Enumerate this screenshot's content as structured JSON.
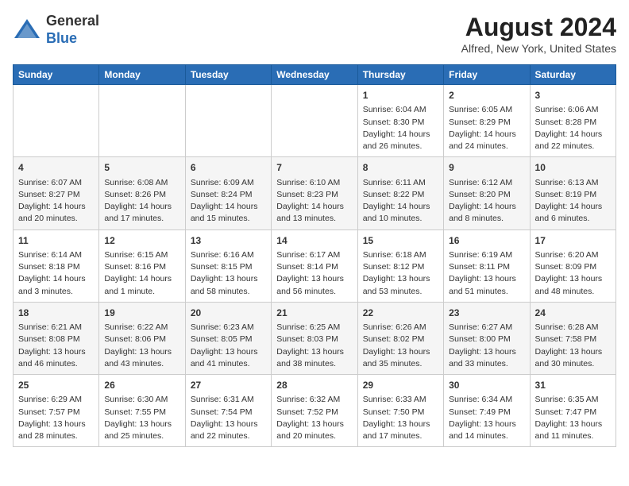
{
  "header": {
    "logo_line1": "General",
    "logo_line2": "Blue",
    "title": "August 2024",
    "subtitle": "Alfred, New York, United States"
  },
  "days_of_week": [
    "Sunday",
    "Monday",
    "Tuesday",
    "Wednesday",
    "Thursday",
    "Friday",
    "Saturday"
  ],
  "weeks": [
    [
      {
        "day": "",
        "lines": []
      },
      {
        "day": "",
        "lines": []
      },
      {
        "day": "",
        "lines": []
      },
      {
        "day": "",
        "lines": []
      },
      {
        "day": "1",
        "lines": [
          "Sunrise: 6:04 AM",
          "Sunset: 8:30 PM",
          "Daylight: 14 hours",
          "and 26 minutes."
        ]
      },
      {
        "day": "2",
        "lines": [
          "Sunrise: 6:05 AM",
          "Sunset: 8:29 PM",
          "Daylight: 14 hours",
          "and 24 minutes."
        ]
      },
      {
        "day": "3",
        "lines": [
          "Sunrise: 6:06 AM",
          "Sunset: 8:28 PM",
          "Daylight: 14 hours",
          "and 22 minutes."
        ]
      }
    ],
    [
      {
        "day": "4",
        "lines": [
          "Sunrise: 6:07 AM",
          "Sunset: 8:27 PM",
          "Daylight: 14 hours",
          "and 20 minutes."
        ]
      },
      {
        "day": "5",
        "lines": [
          "Sunrise: 6:08 AM",
          "Sunset: 8:26 PM",
          "Daylight: 14 hours",
          "and 17 minutes."
        ]
      },
      {
        "day": "6",
        "lines": [
          "Sunrise: 6:09 AM",
          "Sunset: 8:24 PM",
          "Daylight: 14 hours",
          "and 15 minutes."
        ]
      },
      {
        "day": "7",
        "lines": [
          "Sunrise: 6:10 AM",
          "Sunset: 8:23 PM",
          "Daylight: 14 hours",
          "and 13 minutes."
        ]
      },
      {
        "day": "8",
        "lines": [
          "Sunrise: 6:11 AM",
          "Sunset: 8:22 PM",
          "Daylight: 14 hours",
          "and 10 minutes."
        ]
      },
      {
        "day": "9",
        "lines": [
          "Sunrise: 6:12 AM",
          "Sunset: 8:20 PM",
          "Daylight: 14 hours",
          "and 8 minutes."
        ]
      },
      {
        "day": "10",
        "lines": [
          "Sunrise: 6:13 AM",
          "Sunset: 8:19 PM",
          "Daylight: 14 hours",
          "and 6 minutes."
        ]
      }
    ],
    [
      {
        "day": "11",
        "lines": [
          "Sunrise: 6:14 AM",
          "Sunset: 8:18 PM",
          "Daylight: 14 hours",
          "and 3 minutes."
        ]
      },
      {
        "day": "12",
        "lines": [
          "Sunrise: 6:15 AM",
          "Sunset: 8:16 PM",
          "Daylight: 14 hours",
          "and 1 minute."
        ]
      },
      {
        "day": "13",
        "lines": [
          "Sunrise: 6:16 AM",
          "Sunset: 8:15 PM",
          "Daylight: 13 hours",
          "and 58 minutes."
        ]
      },
      {
        "day": "14",
        "lines": [
          "Sunrise: 6:17 AM",
          "Sunset: 8:14 PM",
          "Daylight: 13 hours",
          "and 56 minutes."
        ]
      },
      {
        "day": "15",
        "lines": [
          "Sunrise: 6:18 AM",
          "Sunset: 8:12 PM",
          "Daylight: 13 hours",
          "and 53 minutes."
        ]
      },
      {
        "day": "16",
        "lines": [
          "Sunrise: 6:19 AM",
          "Sunset: 8:11 PM",
          "Daylight: 13 hours",
          "and 51 minutes."
        ]
      },
      {
        "day": "17",
        "lines": [
          "Sunrise: 6:20 AM",
          "Sunset: 8:09 PM",
          "Daylight: 13 hours",
          "and 48 minutes."
        ]
      }
    ],
    [
      {
        "day": "18",
        "lines": [
          "Sunrise: 6:21 AM",
          "Sunset: 8:08 PM",
          "Daylight: 13 hours",
          "and 46 minutes."
        ]
      },
      {
        "day": "19",
        "lines": [
          "Sunrise: 6:22 AM",
          "Sunset: 8:06 PM",
          "Daylight: 13 hours",
          "and 43 minutes."
        ]
      },
      {
        "day": "20",
        "lines": [
          "Sunrise: 6:23 AM",
          "Sunset: 8:05 PM",
          "Daylight: 13 hours",
          "and 41 minutes."
        ]
      },
      {
        "day": "21",
        "lines": [
          "Sunrise: 6:25 AM",
          "Sunset: 8:03 PM",
          "Daylight: 13 hours",
          "and 38 minutes."
        ]
      },
      {
        "day": "22",
        "lines": [
          "Sunrise: 6:26 AM",
          "Sunset: 8:02 PM",
          "Daylight: 13 hours",
          "and 35 minutes."
        ]
      },
      {
        "day": "23",
        "lines": [
          "Sunrise: 6:27 AM",
          "Sunset: 8:00 PM",
          "Daylight: 13 hours",
          "and 33 minutes."
        ]
      },
      {
        "day": "24",
        "lines": [
          "Sunrise: 6:28 AM",
          "Sunset: 7:58 PM",
          "Daylight: 13 hours",
          "and 30 minutes."
        ]
      }
    ],
    [
      {
        "day": "25",
        "lines": [
          "Sunrise: 6:29 AM",
          "Sunset: 7:57 PM",
          "Daylight: 13 hours",
          "and 28 minutes."
        ]
      },
      {
        "day": "26",
        "lines": [
          "Sunrise: 6:30 AM",
          "Sunset: 7:55 PM",
          "Daylight: 13 hours",
          "and 25 minutes."
        ]
      },
      {
        "day": "27",
        "lines": [
          "Sunrise: 6:31 AM",
          "Sunset: 7:54 PM",
          "Daylight: 13 hours",
          "and 22 minutes."
        ]
      },
      {
        "day": "28",
        "lines": [
          "Sunrise: 6:32 AM",
          "Sunset: 7:52 PM",
          "Daylight: 13 hours",
          "and 20 minutes."
        ]
      },
      {
        "day": "29",
        "lines": [
          "Sunrise: 6:33 AM",
          "Sunset: 7:50 PM",
          "Daylight: 13 hours",
          "and 17 minutes."
        ]
      },
      {
        "day": "30",
        "lines": [
          "Sunrise: 6:34 AM",
          "Sunset: 7:49 PM",
          "Daylight: 13 hours",
          "and 14 minutes."
        ]
      },
      {
        "day": "31",
        "lines": [
          "Sunrise: 6:35 AM",
          "Sunset: 7:47 PM",
          "Daylight: 13 hours",
          "and 11 minutes."
        ]
      }
    ]
  ]
}
